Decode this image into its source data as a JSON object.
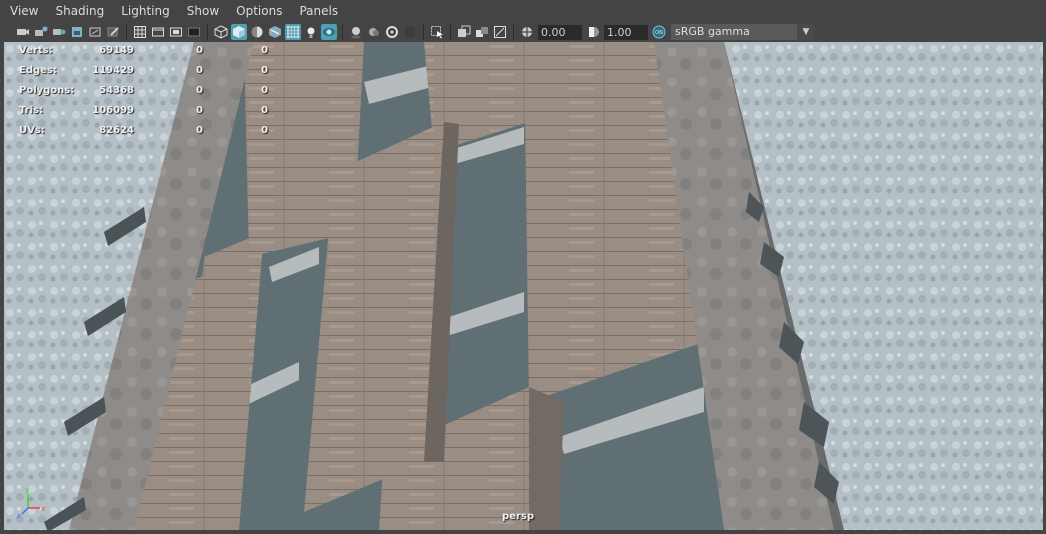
{
  "menu": [
    "View",
    "Shading",
    "Lighting",
    "Show",
    "Options",
    "Panels"
  ],
  "toolbar": {
    "exposure_value": "0.00",
    "gamma_value": "1.00",
    "color_management_label": "sRGB gamma",
    "icons": [
      "camera-select-icon",
      "camera-attributes-icon",
      "bookmark-icon",
      "image-plane-icon",
      "2d-pan-zoom-icon",
      "grease-pencil-icon",
      "grid-icon",
      "film-gate-icon",
      "resolution-gate-icon",
      "gate-mask-icon",
      "wireframe-icon",
      "smooth-shade-icon",
      "default-material-icon",
      "textured-icon",
      "wireframe-on-shaded-icon",
      "use-all-lights-icon",
      "xray-icon",
      "shadows-icon",
      "ambient-occlusion-icon",
      "motion-blur-icon",
      "antialias-icon",
      "isolate-select-icon",
      "xray-joints-icon",
      "xray-active-icon",
      "backface-icon",
      "exposure-icon",
      "gamma-icon",
      "color-management-icon"
    ]
  },
  "hud": {
    "rows": [
      {
        "label": "Verts:",
        "v1": "69149",
        "v2": "0",
        "v3": "0"
      },
      {
        "label": "Edges:",
        "v1": "119429",
        "v2": "0",
        "v3": "0"
      },
      {
        "label": "Polygons:",
        "v1": "54368",
        "v2": "0",
        "v3": "0"
      },
      {
        "label": "Tris:",
        "v1": "106099",
        "v2": "0",
        "v3": "0"
      },
      {
        "label": "UVs:",
        "v1": "82624",
        "v2": "0",
        "v3": "0"
      }
    ]
  },
  "camera_label": "persp",
  "axis": {
    "x": "x",
    "y": "y",
    "z": "z"
  },
  "colors": {
    "active_toggle": "#4f9fb5",
    "panel_bg": "#444444",
    "viewport_bg": "#6e6e6e"
  }
}
